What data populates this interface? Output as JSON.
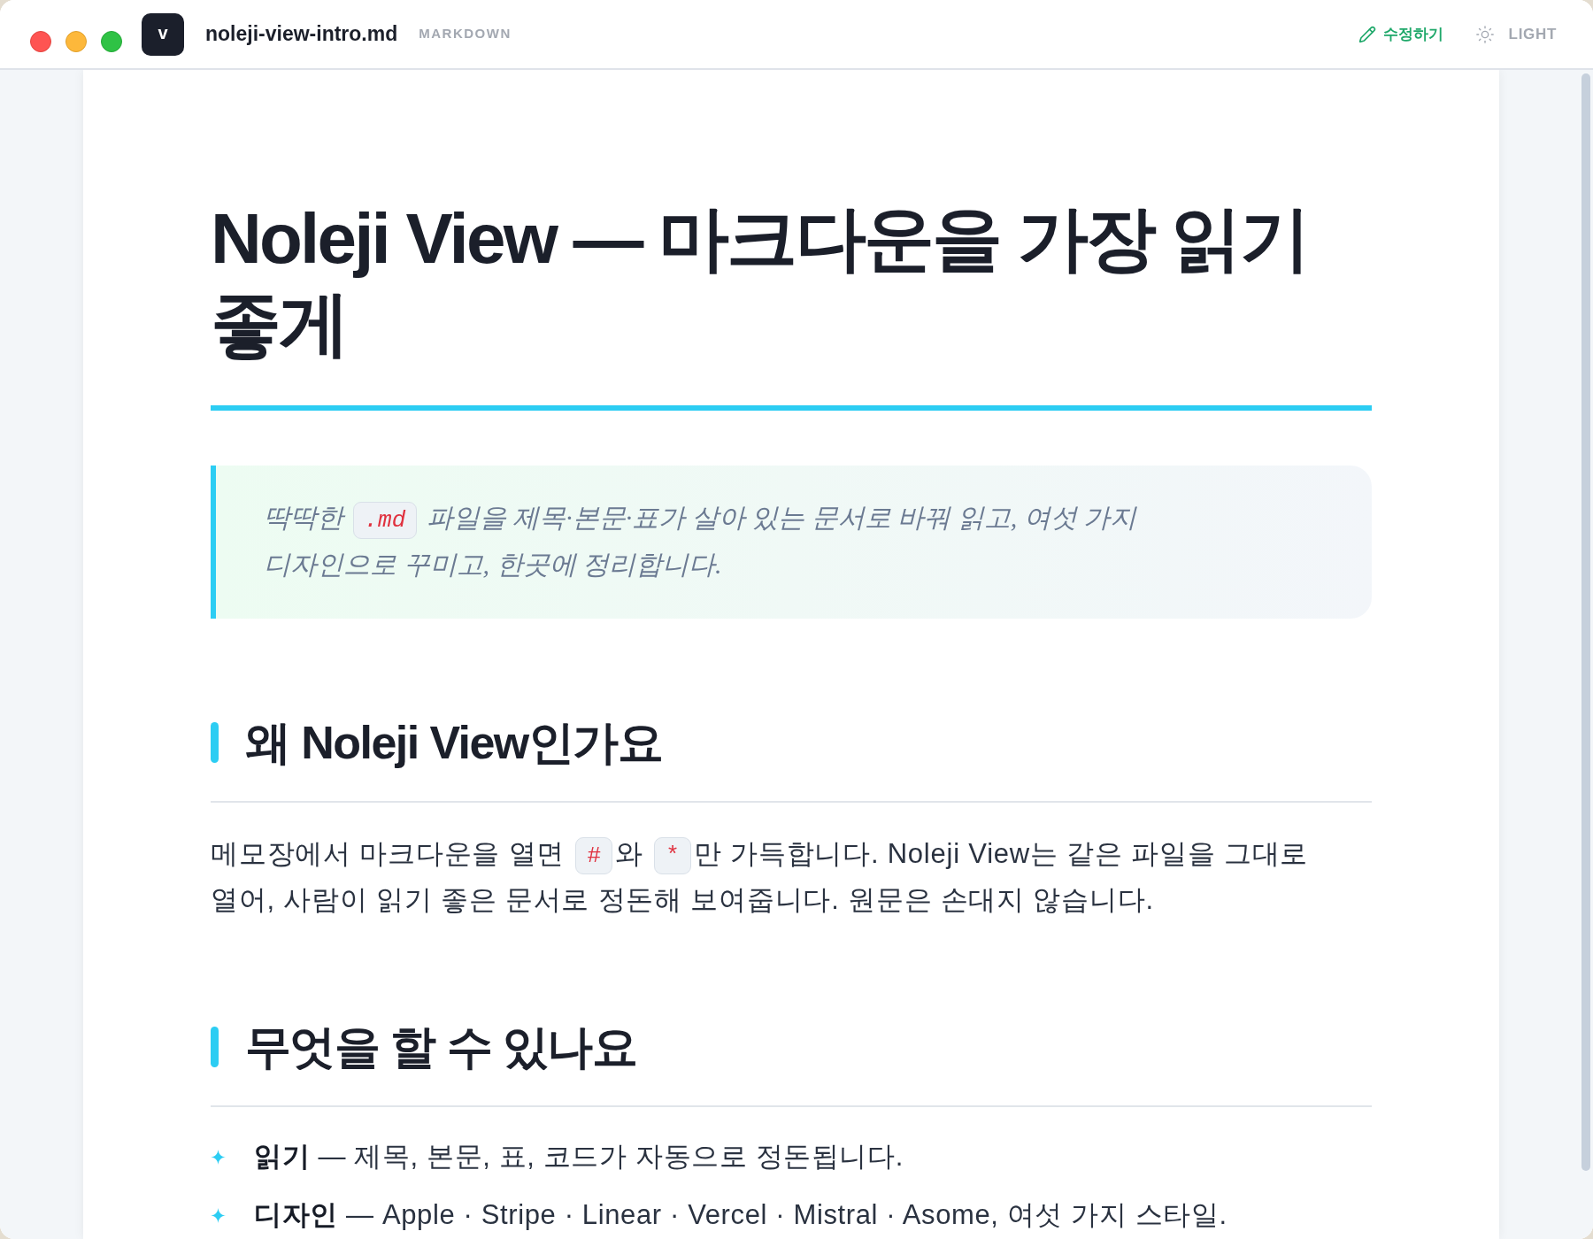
{
  "window": {
    "app_icon": "v",
    "filename": "noleji-view-intro.md",
    "format": "MARKDOWN",
    "actions": [
      {
        "kind": "edit",
        "label": "수정하기"
      },
      {
        "kind": "theme",
        "label": "LIGHT"
      }
    ]
  },
  "document": {
    "title": "Noleji View — 마크다운을 가장 읽기 좋게",
    "callout": [
      {
        "kind": "text",
        "text": "딱딱한 "
      },
      {
        "kind": "code",
        "text": ".md"
      },
      {
        "kind": "text",
        "text": " 파일을 제목·본문·표가 살아 있는 문서로 바꿔 읽고, 여섯 가지 디자인으로 꾸미고, 한곳에 정리합니다."
      }
    ],
    "sections": [
      {
        "heading": "왜 Noleji View인가요",
        "blocks": [
          {
            "kind": "paragraph",
            "parts": [
              {
                "kind": "text",
                "text": "메모장에서 마크다운을 열면 "
              },
              {
                "kind": "code",
                "text": "#"
              },
              {
                "kind": "text",
                "text": "와 "
              },
              {
                "kind": "code",
                "text": "*"
              },
              {
                "kind": "text",
                "text": "만 가득합니다. Noleji View는 같은 파일을 그대로 열어, 사람이 읽기 좋은 문서로 정돈해 보여줍니다. 원문은 손대지 않습니다."
              }
            ]
          }
        ]
      },
      {
        "heading": "무엇을 할 수 있나요",
        "blocks": [
          {
            "kind": "list",
            "items": [
              "**읽기** — 제목, 본문, 표, 코드가 자동으로 정돈됩니다.",
              "**디자인** — Apple · Stripe · Linear · Vercel · Mistral · Asome, 여섯 가지 스타일."
            ]
          }
        ]
      }
    ]
  }
}
